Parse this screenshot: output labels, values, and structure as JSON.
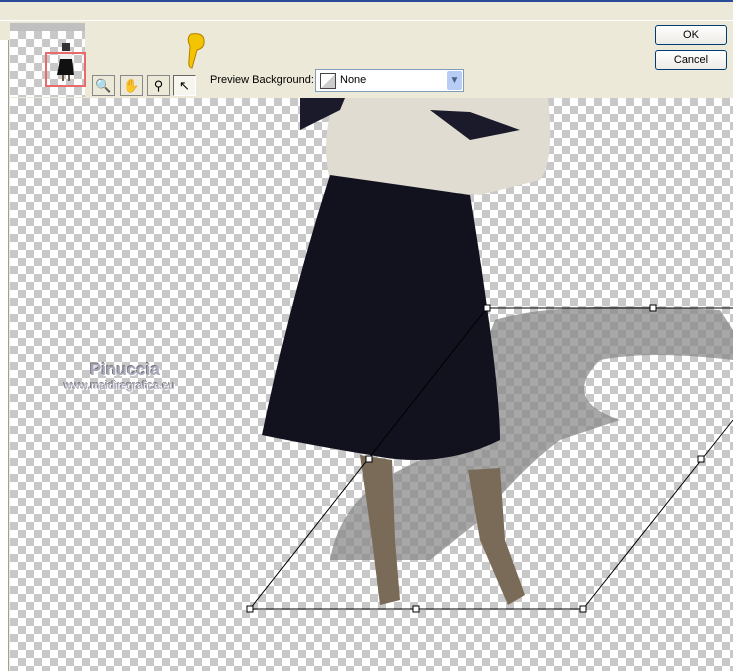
{
  "dialog": {
    "ok_label": "OK",
    "cancel_label": "Cancel"
  },
  "toolbar": {
    "tools": [
      {
        "icon": "pan-zoom-icon"
      },
      {
        "icon": "hand-icon"
      },
      {
        "icon": "magnifier-icon"
      },
      {
        "icon": "arrow-pointer-icon",
        "active": true
      }
    ],
    "preview_background_label": "Preview Background:",
    "preview_background_value": "None"
  },
  "watermark": {
    "name": "Pinuccia",
    "url": "www.maidiregrafica.eu"
  },
  "colors": {
    "selection_frame": "#e86a6a",
    "dialog_bg": "#ece9d8",
    "pointer_hand": "#f5c400"
  }
}
